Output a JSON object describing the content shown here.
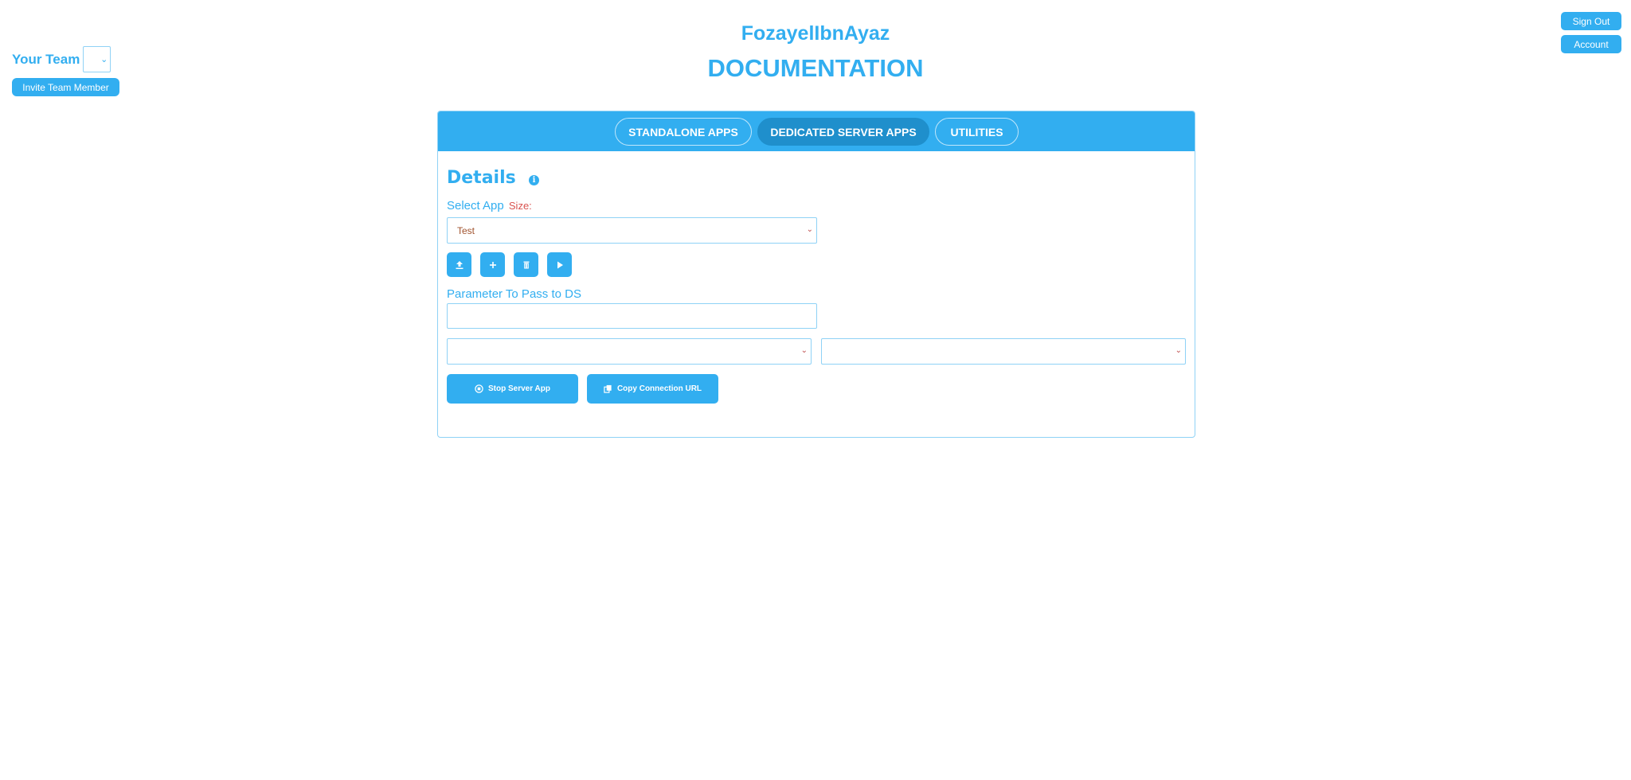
{
  "header": {
    "brand": "FozayelIbnAyaz",
    "page_title": "DOCUMENTATION"
  },
  "team": {
    "label": "Your Team",
    "selected": "",
    "invite_label": "Invite Team Member"
  },
  "user_menu": {
    "signout_label": "Sign Out",
    "account_label": "Account"
  },
  "tabs": [
    {
      "label": "STANDALONE APPS",
      "active": false
    },
    {
      "label": "DEDICATED SERVER APPS",
      "active": true
    },
    {
      "label": "UTILITIES",
      "active": false
    }
  ],
  "details": {
    "title": "Details",
    "info_icon": "info-icon",
    "select_app_label": "Select App",
    "size_label": "Size:",
    "app_selected": "Test",
    "toolbar_icons": [
      "upload-icon",
      "plus-icon",
      "trash-icon",
      "play-icon"
    ],
    "param_label": "Parameter To Pass to DS",
    "param_value": "",
    "left_select_value": "",
    "right_select_value": "",
    "stop_label": "Stop Server App",
    "copy_label": "Copy Connection URL"
  },
  "colors": {
    "accent": "#32aef0",
    "active_tab": "#1f8fcc",
    "border": "#8fd2f6",
    "warning_text": "#d9534f"
  }
}
